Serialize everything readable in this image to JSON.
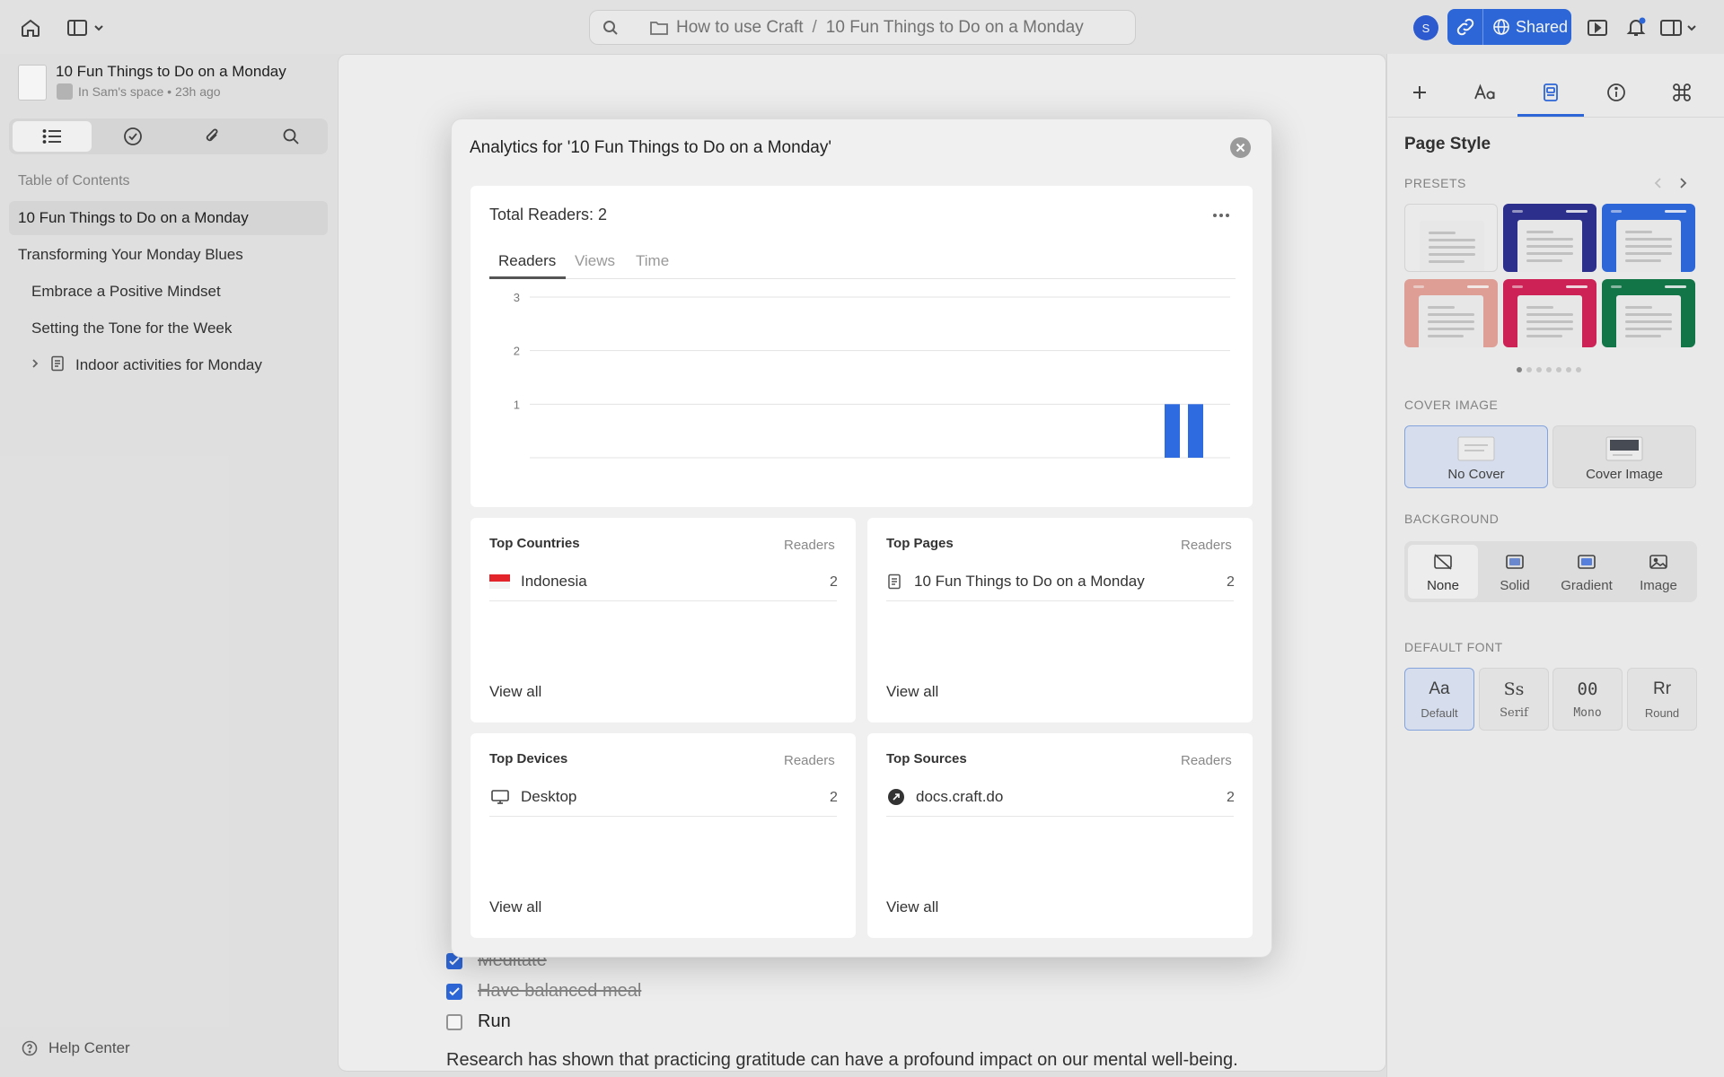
{
  "topbar": {
    "breadcrumb_folder": "How to use Craft",
    "breadcrumb_separator": "/",
    "breadcrumb_page": "10 Fun Things to Do on a Monday",
    "avatar_initial": "S",
    "share_label": "Shared"
  },
  "sidebar": {
    "doc_title": "10 Fun Things to Do on a Monday",
    "doc_subtitle": "In Sam's space • 23h ago",
    "toc_label": "Table of Contents",
    "toc": [
      {
        "label": "10 Fun Things to Do on a Monday",
        "active": true
      },
      {
        "label": "Transforming Your Monday Blues"
      },
      {
        "label": "Embrace a Positive Mindset"
      },
      {
        "label": "Setting the Tone for the Week"
      },
      {
        "label": "Indoor activities for Monday"
      }
    ],
    "help_label": "Help Center"
  },
  "editor": {
    "todos": [
      {
        "label": "Meditate",
        "checked": true
      },
      {
        "label": "Have balanced meal",
        "checked": true
      },
      {
        "label": "Run",
        "checked": false
      }
    ],
    "research_line": "Research has shown that practicing gratitude can have a profound impact on our mental well-being."
  },
  "modal": {
    "title": "Analytics for '10 Fun Things to Do on a Monday'",
    "total_readers": "Total Readers: 2",
    "tabs": [
      "Readers",
      "Views",
      "Time"
    ],
    "active_tab": "Readers",
    "cards": {
      "countries": {
        "heading": "Top Countries",
        "col": "Readers",
        "row_label": "Indonesia",
        "row_value": "2",
        "view_all": "View all"
      },
      "pages": {
        "heading": "Top Pages",
        "col": "Readers",
        "row_label": "10 Fun Things to Do on a Monday",
        "row_value": "2",
        "view_all": "View all"
      },
      "devices": {
        "heading": "Top Devices",
        "col": "Readers",
        "row_label": "Desktop",
        "row_value": "2",
        "view_all": "View all"
      },
      "sources": {
        "heading": "Top Sources",
        "col": "Readers",
        "row_label": "docs.craft.do",
        "row_value": "2",
        "view_all": "View all"
      }
    }
  },
  "chart_data": {
    "type": "bar",
    "y_ticks": [
      "3",
      "2",
      "1"
    ],
    "ylim": [
      0,
      3
    ],
    "values": [
      1,
      1
    ],
    "bar_color": "#2f6be0"
  },
  "right_panel": {
    "title": "Page Style",
    "presets_label": "PRESETS",
    "presets": [
      {
        "color": "#f4f4f4"
      },
      {
        "color": "#2e3192"
      },
      {
        "color": "#2f6be0"
      },
      {
        "color": "#e8a59c"
      },
      {
        "color": "#d6245a"
      },
      {
        "color": "#137a4a"
      }
    ],
    "cover_label": "COVER IMAGE",
    "cover_options": [
      "No Cover",
      "Cover Image"
    ],
    "background_label": "BACKGROUND",
    "background_options": [
      "None",
      "Solid",
      "Gradient",
      "Image"
    ],
    "font_label": "DEFAULT FONT",
    "fonts": [
      {
        "glyph": "Aa",
        "label": "Default"
      },
      {
        "glyph": "Ss",
        "label": "Serif"
      },
      {
        "glyph": "00",
        "label": "Mono"
      },
      {
        "glyph": "Rr",
        "label": "Round"
      }
    ]
  },
  "colors": {
    "accent": "#2f6be0"
  }
}
